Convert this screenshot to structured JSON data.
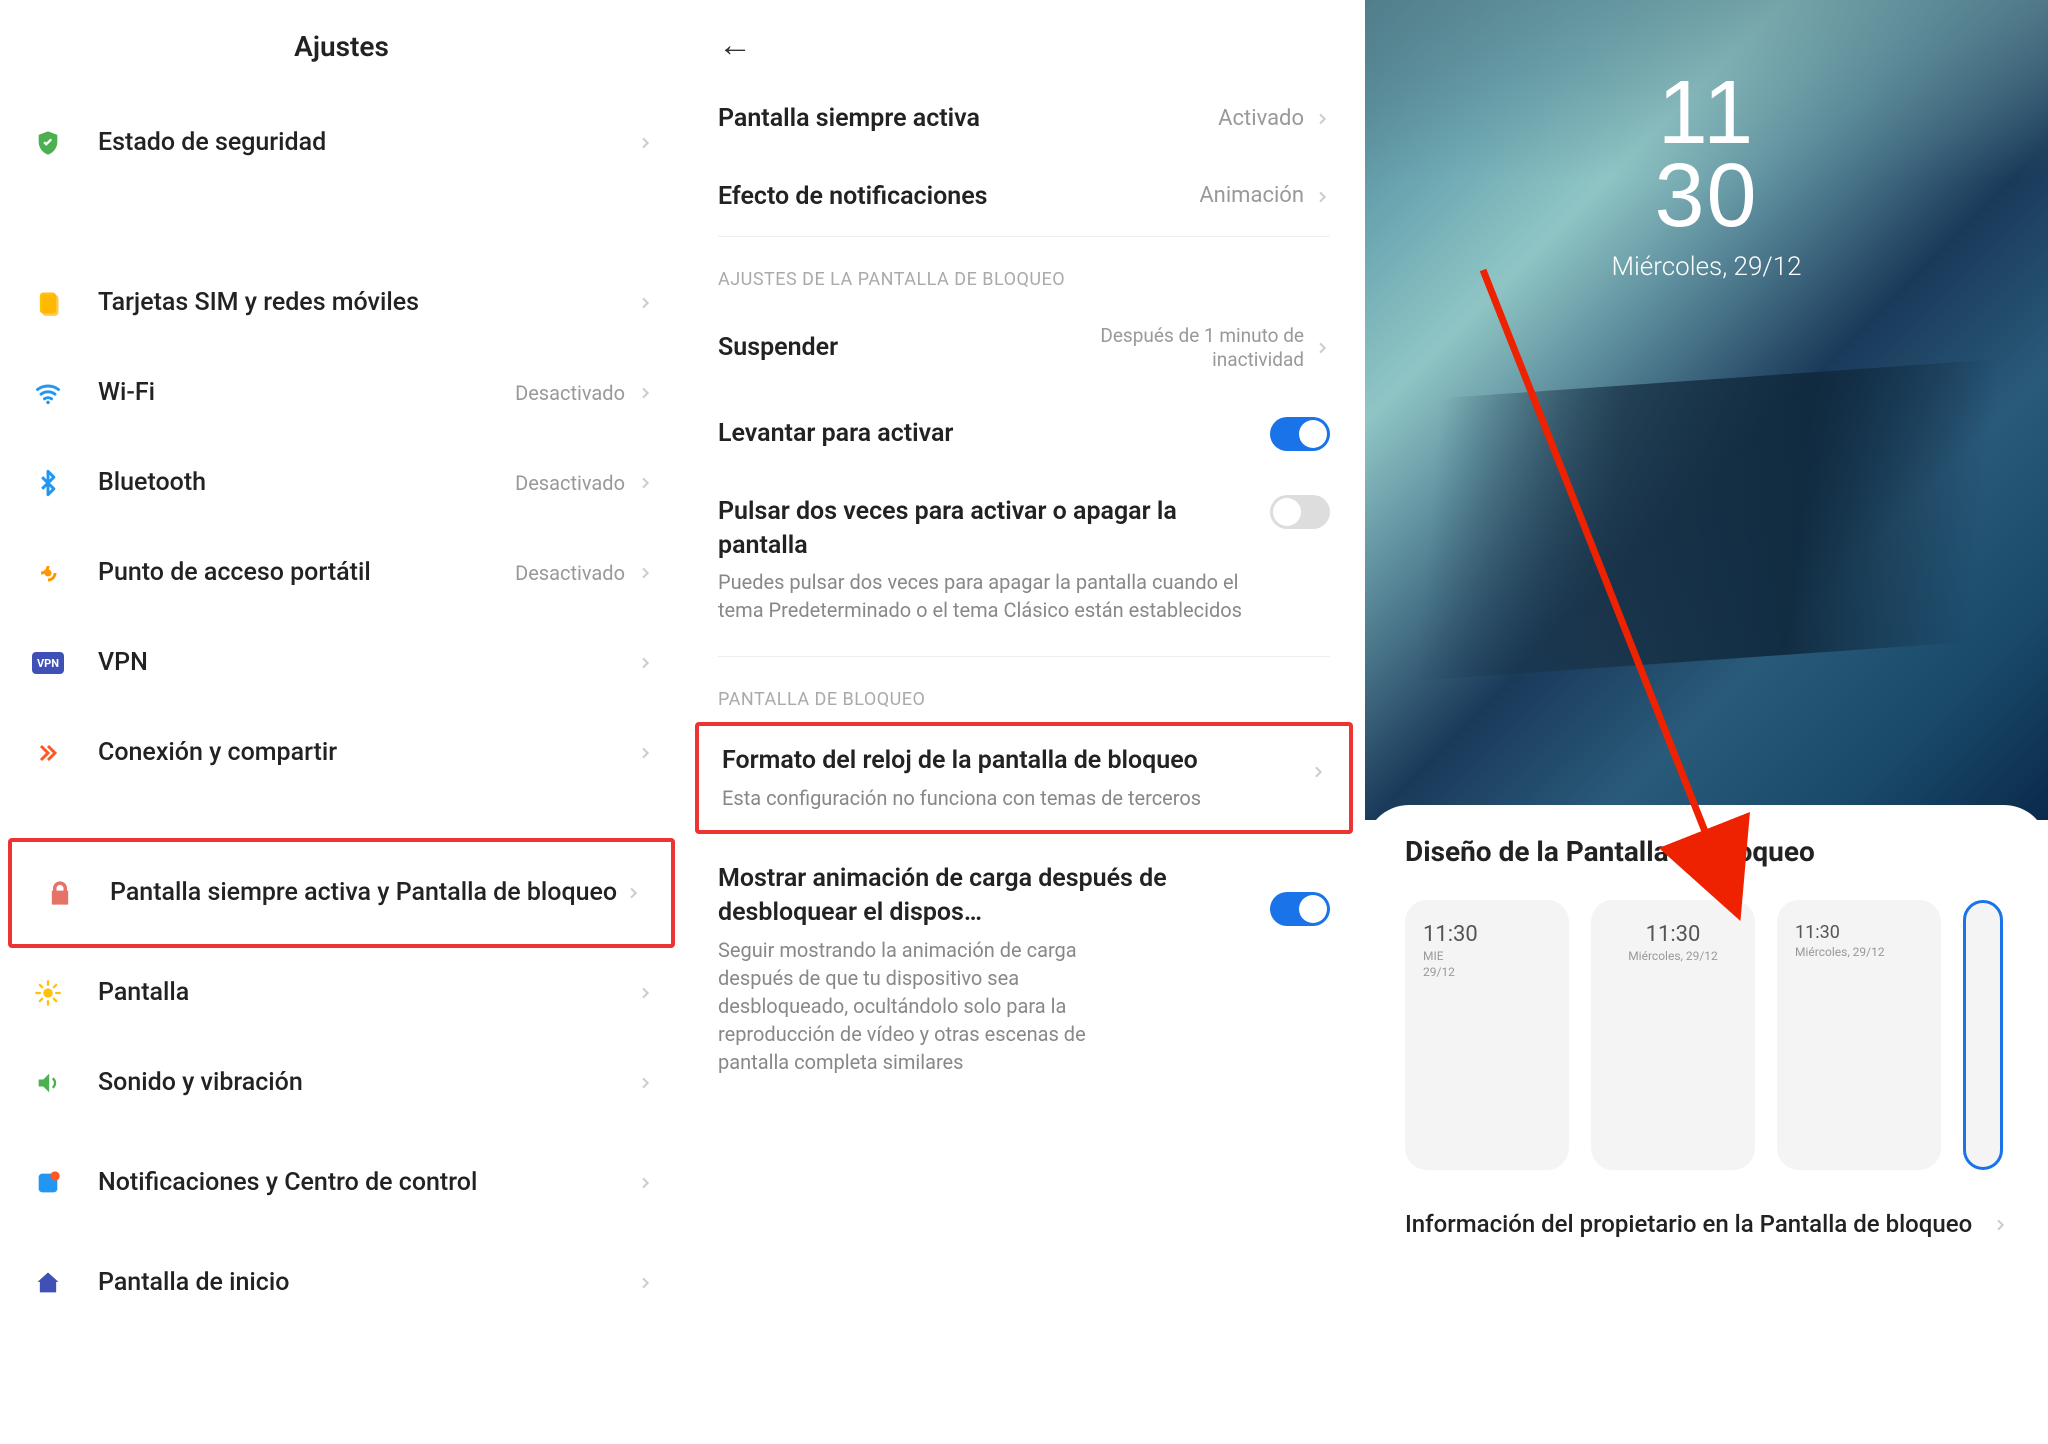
{
  "panel1": {
    "title": "Ajustes",
    "items": [
      {
        "label": "Estado de seguridad",
        "value": ""
      },
      {
        "label": "Tarjetas SIM y redes móviles",
        "value": ""
      },
      {
        "label": "Wi-Fi",
        "value": "Desactivado"
      },
      {
        "label": "Bluetooth",
        "value": "Desactivado"
      },
      {
        "label": "Punto de acceso portátil",
        "value": "Desactivado"
      },
      {
        "label": "VPN",
        "value": ""
      },
      {
        "label": "Conexión y compartir",
        "value": ""
      },
      {
        "label": "Pantalla siempre activa y Pantalla de bloqueo",
        "value": ""
      },
      {
        "label": "Pantalla",
        "value": ""
      },
      {
        "label": "Sonido y vibración",
        "value": ""
      },
      {
        "label": "Notificaciones y Centro de control",
        "value": ""
      },
      {
        "label": "Pantalla de inicio",
        "value": ""
      }
    ]
  },
  "panel2": {
    "rows": {
      "aod": {
        "title": "Pantalla siempre activa",
        "value": "Activado"
      },
      "notif": {
        "title": "Efecto de notificaciones",
        "value": "Animación"
      },
      "section1": "AJUSTES DE LA PANTALLA DE BLOQUEO",
      "sleep": {
        "title": "Suspender",
        "value": "Después de 1 minuto de inactividad"
      },
      "raise": {
        "title": "Levantar para activar"
      },
      "dtap": {
        "title": "Pulsar dos veces para activar o apagar la pantalla",
        "sub": "Puedes pulsar dos veces para apagar la pantalla cuando el tema Predeterminado o el tema Clásico están establecidos"
      },
      "section2": "PANTALLA DE BLOQUEO",
      "clock": {
        "title": "Formato del reloj de la pantalla de bloqueo",
        "sub": "Esta configuración no funciona con temas de terceros"
      },
      "charge": {
        "title": "Mostrar animación de carga después de desbloquear el dispos…",
        "sub": "Seguir mostrando la animación de carga después de que tu dispositivo sea desbloqueado, ocultándolo solo para la reproducción de vídeo y otras escenas de pantalla completa similares"
      }
    }
  },
  "panel3": {
    "clock_h": "11",
    "clock_m": "30",
    "date": "Miércoles, 29/12",
    "sheet_title": "Diseño de la Pantalla de bloqueo",
    "thumbs": [
      {
        "time": "11:30",
        "date1": "MIE",
        "date2": "29/12"
      },
      {
        "time": "11:30",
        "date1": "Miércoles, 29/12"
      },
      {
        "time": "11:30",
        "date1": "Miércoles, 29/12"
      }
    ],
    "owner": "Información del propietario en la Pantalla de bloqueo"
  }
}
